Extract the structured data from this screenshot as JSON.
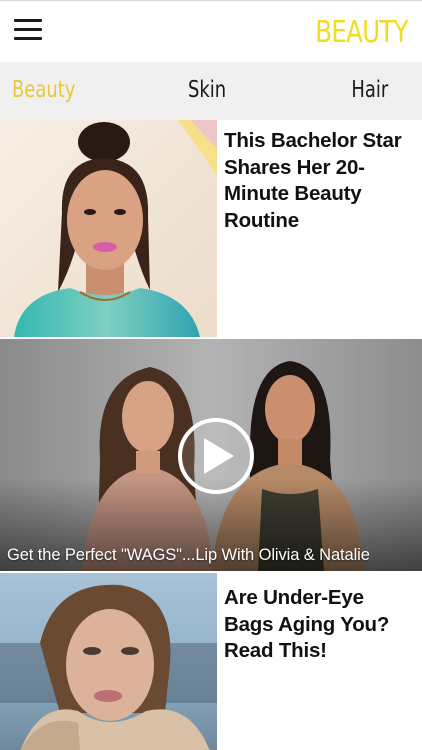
{
  "header": {
    "brand": "BEAUTY",
    "brand_color": "#f2dc1f",
    "menu_icon": "hamburger-menu-icon"
  },
  "tabs": [
    {
      "label": "Beauty",
      "active": true,
      "color": "#e5c93a"
    },
    {
      "label": "Skin",
      "active": false,
      "color": "#1a1a1a"
    },
    {
      "label": "Hair",
      "active": false,
      "color": "#1a1a1a"
    }
  ],
  "articles": [
    {
      "headline": "This Bachelor Star Shares Her 20-Minute Beauty Routine"
    },
    {
      "headline": "Are Under-Eye Bags Aging You? Read This!"
    }
  ],
  "video": {
    "caption": "Get the Perfect \"WAGS\"...Lip With Olivia & Natalie",
    "play_icon": "play-icon"
  }
}
